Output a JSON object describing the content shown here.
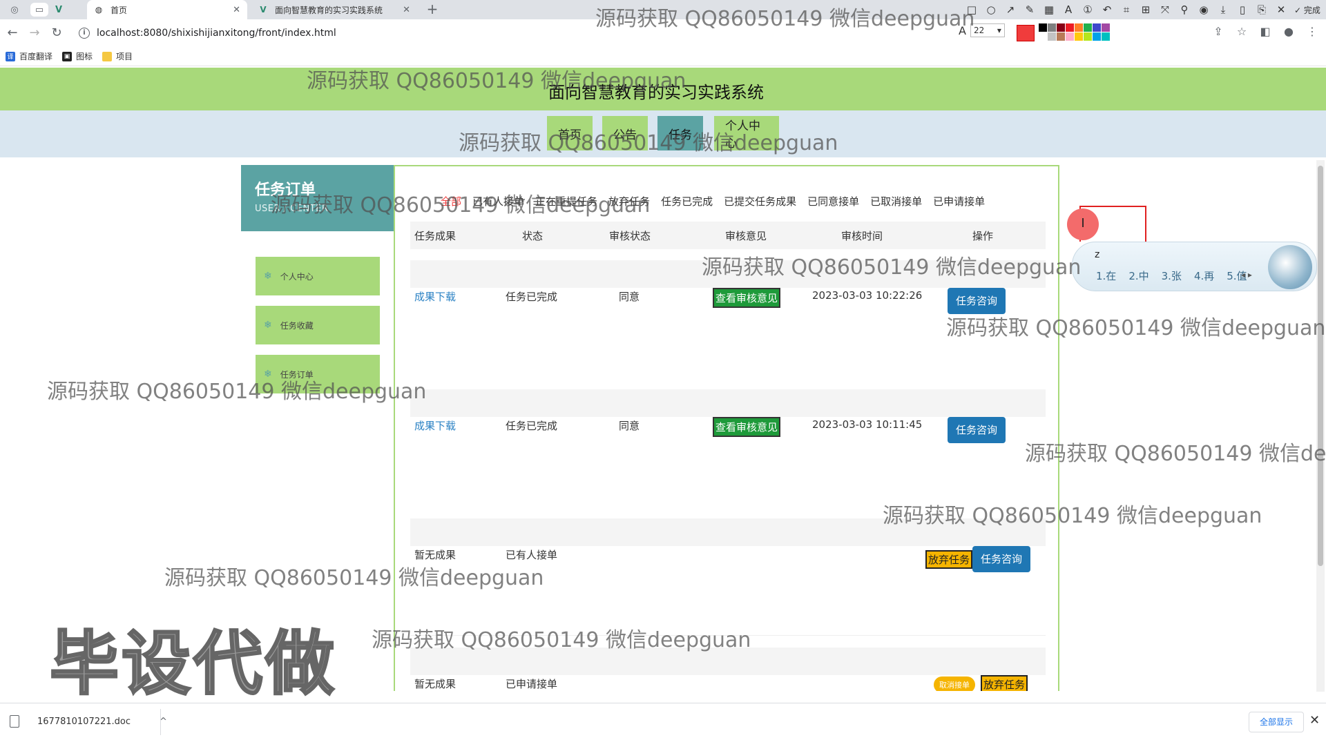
{
  "browser": {
    "tabs": [
      {
        "title": "首页",
        "active": true
      },
      {
        "title": "面向智慧教育的实习实践系统",
        "active": false
      }
    ],
    "url": "localhost:8080/shixishijianxitong/front/index.html",
    "font_size_value": "22",
    "done_label": "完成",
    "bookmarks": [
      {
        "label": "百度翻译",
        "icon": "translate-icon"
      },
      {
        "label": "图标",
        "icon": "image-icon"
      },
      {
        "label": "项目",
        "icon": "folder-icon"
      }
    ],
    "palette": [
      "#000000",
      "#7f7f7f",
      "#880015",
      "#ed1c24",
      "#ff7f27",
      "#22b14c",
      "#3f48cc",
      "#a349a4",
      "#ffffff",
      "#c3c3c3",
      "#b97a57",
      "#ffaec9",
      "#ffc90e",
      "#b5e61d",
      "#00a2e8",
      "#00c0c0"
    ]
  },
  "site": {
    "title": "面向智慧教育的实习实践系统",
    "nav": [
      "首页",
      "公告",
      "任务",
      "个人中心"
    ],
    "nav_active_index": 2
  },
  "sidebar": {
    "title": "任务订单",
    "subtitle": "USER / CENTER",
    "items": [
      "个人中心",
      "任务收藏",
      "任务订单"
    ]
  },
  "orders": {
    "filters": [
      "全部",
      "已有人接单",
      "正在重提任务",
      "放弃任务",
      "任务已完成",
      "已提交任务成果",
      "已同意接单",
      "已取消接单",
      "已申请接单"
    ],
    "filter_active_index": 0,
    "columns": [
      "任务成果",
      "状态",
      "审核状态",
      "审核意见",
      "审核时间",
      "操作"
    ],
    "rows": [
      {
        "result": "成果下载",
        "status": "任务已完成",
        "review_status": "同意",
        "opinion_button": "查看审核意见",
        "time": "2023-03-03 10:22:26",
        "actions": [
          "任务咨询"
        ]
      },
      {
        "result": "成果下载",
        "status": "任务已完成",
        "review_status": "同意",
        "opinion_button": "查看审核意见",
        "time": "2023-03-03 10:11:45",
        "actions": [
          "任务咨询"
        ]
      },
      {
        "result": "暂无成果",
        "status": "已有人接单",
        "review_status": "",
        "opinion_button": "",
        "time": "",
        "actions": [
          "放弃任务",
          "任务咨询"
        ]
      },
      {
        "result": "暂无成果",
        "status": "已申请接单",
        "review_status": "",
        "opinion_button": "",
        "time": "",
        "actions": [
          "取消接单",
          "放弃任务"
        ]
      }
    ]
  },
  "ime": {
    "input": "z",
    "candidates": [
      "1.在",
      "2.中",
      "3.张",
      "4.再",
      "5.值"
    ]
  },
  "watermark": {
    "text": "源码获取 QQ86050149 微信deepguan",
    "big_text": "毕设代做"
  },
  "downloads": {
    "file": "1677810107221.doc",
    "show_all": "全部显示"
  }
}
